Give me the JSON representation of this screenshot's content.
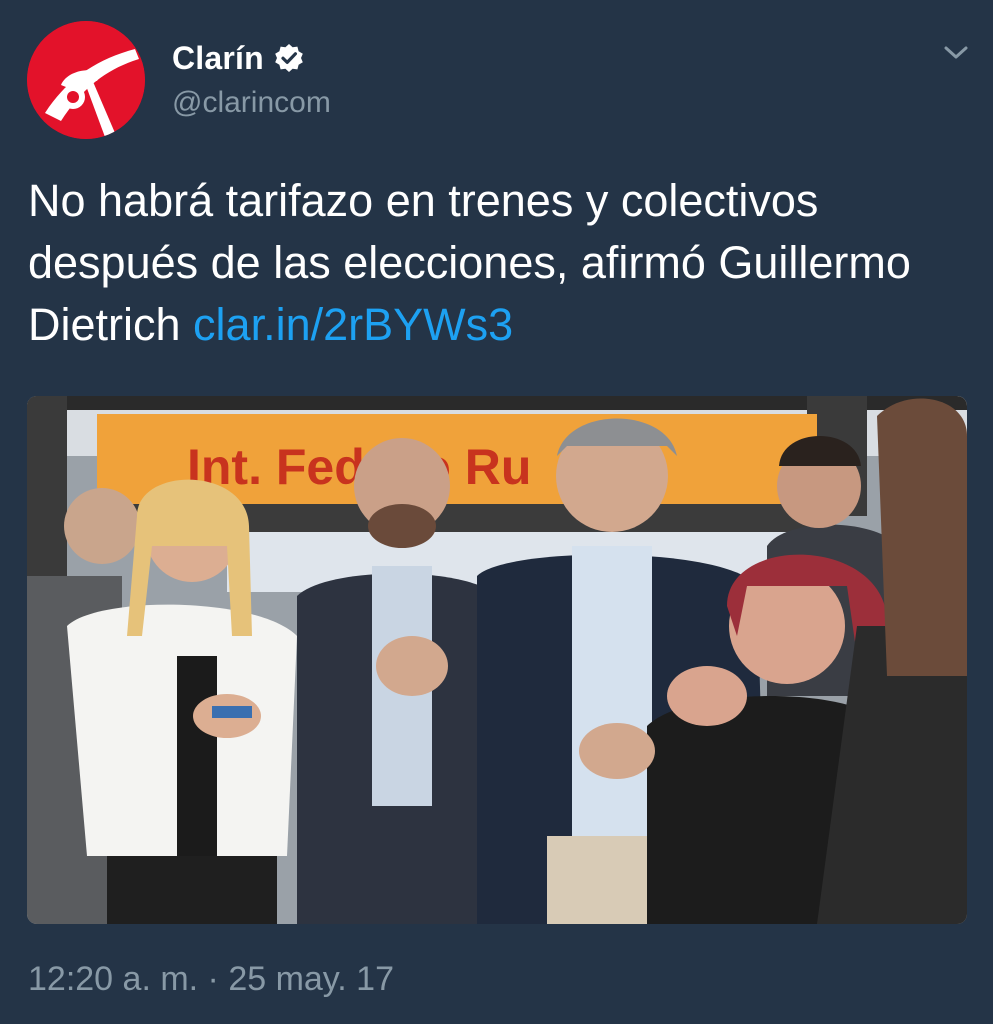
{
  "author": {
    "display_name": "Clarín",
    "handle": "@clarincom",
    "verified": true,
    "avatar_icon": "clarin-logo",
    "brand_color": "#e3122a"
  },
  "tweet": {
    "text_before_link": "No habrá tarifazo en trenes y colectivos después de las elecciones, afirmó Guillermo Dietrich ",
    "link_text": "clar.in/2rBYWs3",
    "link_color": "#1da1f2",
    "timestamp": "12:20 a. m. · 25 may. 17"
  },
  "media": {
    "sign_text": "Int. Fed   ico Ru"
  },
  "icons": {
    "menu": "chevron-down-icon",
    "verified": "verified-badge-icon"
  },
  "colors": {
    "background": "#243447",
    "secondary_text": "#8899a6"
  }
}
